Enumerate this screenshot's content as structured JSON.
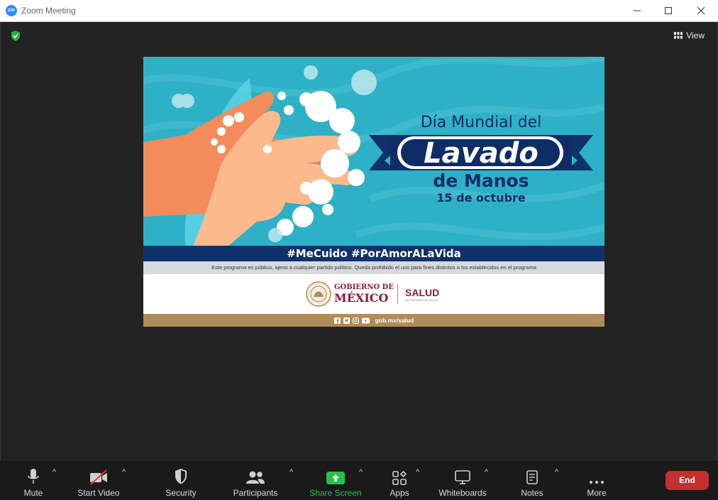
{
  "window": {
    "title": "Zoom Meeting",
    "app_icon_text": "zm"
  },
  "meeting": {
    "view_label": "View"
  },
  "shared": {
    "heading_line1": "Día Mundial del",
    "heading_main": "Lavado",
    "heading_line3": "de Manos",
    "date": "15 de octubre",
    "hashtags": "#MeCuido #PorAmorALaVida",
    "disclaimer": "Este programa es público, ajeno a cualquier partido político. Queda prohibido el uso para fines distintos a los establecidos en el programa",
    "gov_line1": "GOBIERNO DE",
    "gov_line2": "MÉXICO",
    "salud": "SALUD",
    "salud_sub": "SECRETARÍA DE SALUD",
    "website": "gob.mx/salud"
  },
  "toolbar": {
    "mute": "Mute",
    "start_video": "Start Video",
    "security": "Security",
    "participants": "Participants",
    "share_screen": "Share Screen",
    "apps": "Apps",
    "whiteboards": "Whiteboards",
    "notes": "Notes",
    "more": "More",
    "end": "End"
  },
  "colors": {
    "share_green": "#25c14a",
    "end_red": "#c52f2f",
    "slide_teal": "#2eb1c7",
    "navy": "#10316b",
    "gold": "#b18b59",
    "maroon": "#8a1c3a"
  }
}
